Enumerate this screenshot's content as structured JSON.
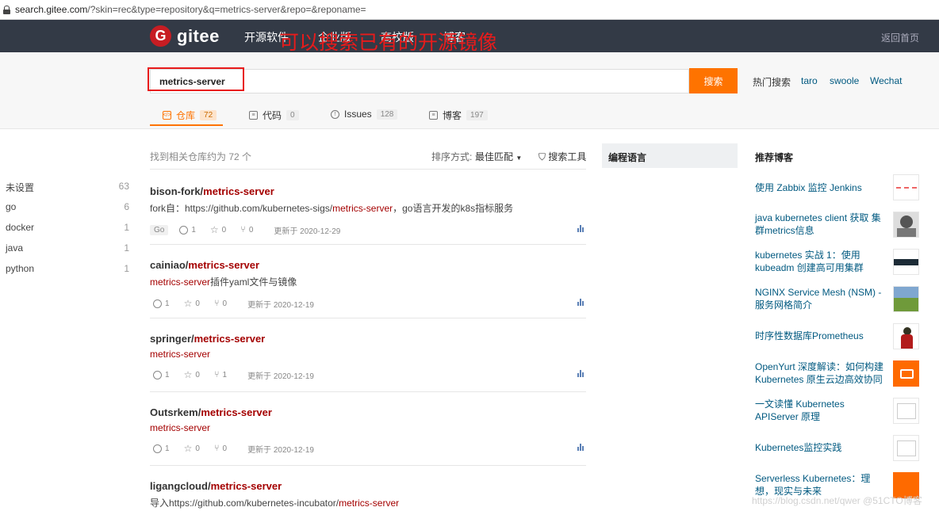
{
  "browser": {
    "url_host": "search.gitee.com",
    "url_path": "/?skin=rec&type=repository&q=metrics-server&repo=&reponame="
  },
  "nav": {
    "logo_mark": "G",
    "logo_text": "gitee",
    "items": [
      "开源软件",
      "企业版",
      "高校版",
      "博客"
    ],
    "back_home": "返回首页"
  },
  "search": {
    "query": "metrics-server",
    "button": "搜索",
    "annotation": "可以搜索已有的开源镜像",
    "hot_label": "热门搜索",
    "hot_terms": [
      "taro",
      "swoole",
      "Wechat"
    ]
  },
  "tabs": [
    {
      "label": "仓库",
      "count": "72",
      "icon": "repo-icon"
    },
    {
      "label": "代码",
      "count": "0",
      "icon": "code-icon"
    },
    {
      "label": "Issues",
      "count": "128",
      "icon": "issue-icon"
    },
    {
      "label": "博客",
      "count": "197",
      "icon": "blog-icon"
    }
  ],
  "results_header": {
    "summary": "找到相关仓库约为 72 个",
    "sort_label": "排序方式:",
    "sort_value": "最佳匹配",
    "tools": "搜索工具"
  },
  "results": [
    {
      "owner": "bison-fork/",
      "name": "metrics-server",
      "desc_pre": "fork自：https://github.com/kubernetes-sigs/",
      "desc_hl": "metrics-server",
      "desc_post": "，go语言开发的k8s指标服务",
      "lang": "Go",
      "watch": "1",
      "star": "0",
      "fork": "0",
      "updated": "更新于 2020-12-29"
    },
    {
      "owner": "cainiao/",
      "name": "metrics-server",
      "desc_pre": "",
      "desc_hl": "metrics-server",
      "desc_post": "插件yaml文件与镜像",
      "lang": "",
      "watch": "1",
      "star": "0",
      "fork": "0",
      "updated": "更新于 2020-12-19"
    },
    {
      "owner": "springer/",
      "name": "metrics-server",
      "desc_pre": "",
      "desc_hl": "metrics-server",
      "desc_post": "",
      "lang": "",
      "watch": "1",
      "star": "0",
      "fork": "1",
      "updated": "更新于 2020-12-19"
    },
    {
      "owner": "Outsrkem/",
      "name": "metrics-server",
      "desc_pre": "",
      "desc_hl": "metrics-server",
      "desc_post": "",
      "lang": "",
      "watch": "1",
      "star": "0",
      "fork": "0",
      "updated": "更新于 2020-12-19"
    },
    {
      "owner": "ligangcloud/",
      "name": "metrics-server",
      "desc_pre": "导入https://github.com/kubernetes-incubator/",
      "desc_hl": "metrics-server",
      "desc_post": "",
      "lang": "",
      "watch": "",
      "star": "",
      "fork": "",
      "updated": ""
    }
  ],
  "languages": {
    "title": "编程语言",
    "rows": [
      {
        "name": "未设置",
        "count": "63"
      },
      {
        "name": "go",
        "count": "6"
      },
      {
        "name": "docker",
        "count": "1"
      },
      {
        "name": "java",
        "count": "1"
      },
      {
        "name": "python",
        "count": "1"
      }
    ]
  },
  "blogs": {
    "title": "推荐博客",
    "items": [
      "使用 Zabbix 监控 Jenkins",
      "java kubernetes client 获取 集群metrics信息",
      "kubernetes 实战 1：使用kubeadm 创建高可用集群",
      "NGINX Service Mesh (NSM) -服务网格简介",
      "时序性数据库Prometheus",
      "OpenYurt 深度解读：如何构建 Kubernetes 原生云边高效协同",
      "一文读懂 Kubernetes APIServer 原理",
      "Kubernetes监控实践",
      "Serverless Kubernetes：理想，现实与未来"
    ]
  },
  "watermark": "https://blog.csdn.net/qwer @51CTO博客",
  "colors": {
    "brand": "#c71d23",
    "accent": "#fe7300",
    "highlight": "#a40000",
    "link": "#005980",
    "annotation": "#e81b1b"
  }
}
